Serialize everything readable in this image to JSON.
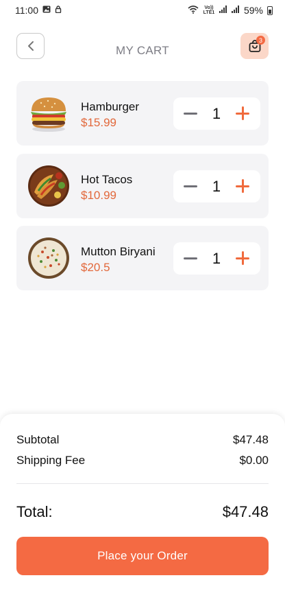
{
  "status_bar": {
    "time": "11:00",
    "network": "Vo)) LTE1",
    "battery": "59%"
  },
  "header": {
    "title": "MY CART",
    "cart_count": "3"
  },
  "items": [
    {
      "name": "Hamburger",
      "price": "$15.99",
      "quantity": "1"
    },
    {
      "name": "Hot Tacos",
      "price": "$10.99",
      "quantity": "1"
    },
    {
      "name": "Mutton Biryani",
      "price": "$20.5",
      "quantity": "1"
    }
  ],
  "summary": {
    "subtotal_label": "Subtotal",
    "subtotal_value": "$47.48",
    "shipping_label": "Shipping Fee",
    "shipping_value": "$0.00",
    "total_label": "Total:",
    "total_value": "$47.48"
  },
  "order_button": "Place your Order",
  "colors": {
    "accent": "#f46a43",
    "price": "#e2683b",
    "card_bg": "#f4f4f6",
    "cart_button_bg": "#fbd7c8"
  }
}
